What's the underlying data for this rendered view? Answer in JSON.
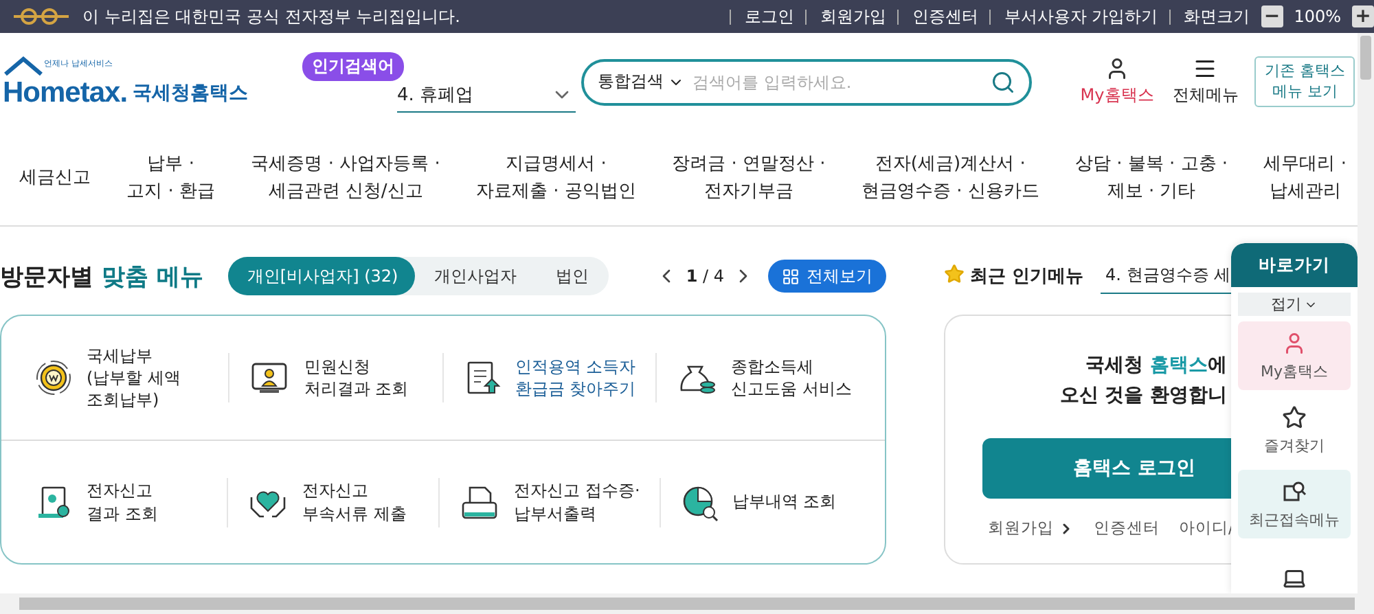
{
  "notice_bar": {
    "text": "이 누리집은 대한민국 공식 전자정부 누리집입니다.",
    "links": [
      "로그인",
      "회원가입",
      "인증센터",
      "부서사용자 가입하기"
    ],
    "zoom_label": "화면크기",
    "zoom_minus": "−",
    "zoom_value": "100%",
    "zoom_plus": "+"
  },
  "header": {
    "logo_tagline": "언제나 납세서비스",
    "logo_brand": "Hometax.",
    "logo_name": "국세청홈택스",
    "popular_badge": "인기검색어",
    "popular_term": "4. 휴폐업",
    "search_scope": "통합검색",
    "search_placeholder": "검색어를 입력하세요.",
    "my_label": "My홈택스",
    "all_menu_label": "전체메뉴",
    "legacy_button": [
      "기존 홈택스",
      "메뉴 보기"
    ]
  },
  "nav": [
    [
      "세금신고"
    ],
    [
      "납부 ·",
      "고지 · 환급"
    ],
    [
      "국세증명 · 사업자등록 ·",
      "세금관련 신청/신고"
    ],
    [
      "지급명세서 ·",
      "자료제출 · 공익법인"
    ],
    [
      "장려금 · 연말정산 ·",
      "전자기부금"
    ],
    [
      "전자(세금)계산서 ·",
      "현금영수증 · 신용카드"
    ],
    [
      "상담 · 불복 · 고충 ·",
      "제보 · 기타"
    ],
    [
      "세무대리 ·",
      "납세관리"
    ]
  ],
  "visitor": {
    "title": "방문자별",
    "title_highlight": "맞춤 메뉴",
    "tabs": [
      {
        "label": "개인[비사업자] (32)",
        "selected": true
      },
      {
        "label": "개인사업자",
        "selected": false
      },
      {
        "label": "법인",
        "selected": false
      }
    ],
    "pager": "**1** / 4",
    "view_all": "전체보기",
    "menu": [
      {
        "lines": [
          "국세납부",
          "(납부할 세액",
          "조회납부)"
        ],
        "highlighted": false
      },
      {
        "lines": [
          "민원신청",
          "처리결과 조회"
        ],
        "highlighted": false
      },
      {
        "lines": [
          "인적용역 소득자",
          "환급금 찾아주기"
        ],
        "highlighted": true
      },
      {
        "lines": [
          "종합소득세",
          "신고도움 서비스"
        ],
        "highlighted": false
      },
      {
        "lines": [
          "전자신고",
          "결과 조회"
        ],
        "highlighted": false
      },
      {
        "lines": [
          "전자신고",
          "부속서류 제출"
        ],
        "highlighted": false
      },
      {
        "lines": [
          "전자신고 접수증·",
          "납부서출력"
        ],
        "highlighted": false
      },
      {
        "lines": [
          "납부내역 조회"
        ],
        "highlighted": false
      }
    ]
  },
  "popular_menu": {
    "label": "최근 인기메뉴",
    "term": "4. 현금영수증 세"
  },
  "welcome": {
    "before": "국세청 ",
    "brand": "홈택스",
    "after": "에",
    "line2": "오신 것을 환영합니",
    "login_button": "홈택스 로그인",
    "links": [
      {
        "label": "회원가입",
        "chevron": true
      },
      {
        "label": "인증센터",
        "chevron": false
      },
      {
        "label": "아이디/",
        "chevron": false
      }
    ]
  },
  "quick_menu": {
    "title": "바로가기",
    "collapse": "접기",
    "items": [
      {
        "label": "My홈택스",
        "color": "#fbe9ee"
      },
      {
        "label": "즐겨찾기",
        "color": "#ffffff"
      },
      {
        "label": "최근접속메뉴",
        "color": "#e8f4f4"
      },
      {
        "color": "#ffffff"
      }
    ]
  }
}
